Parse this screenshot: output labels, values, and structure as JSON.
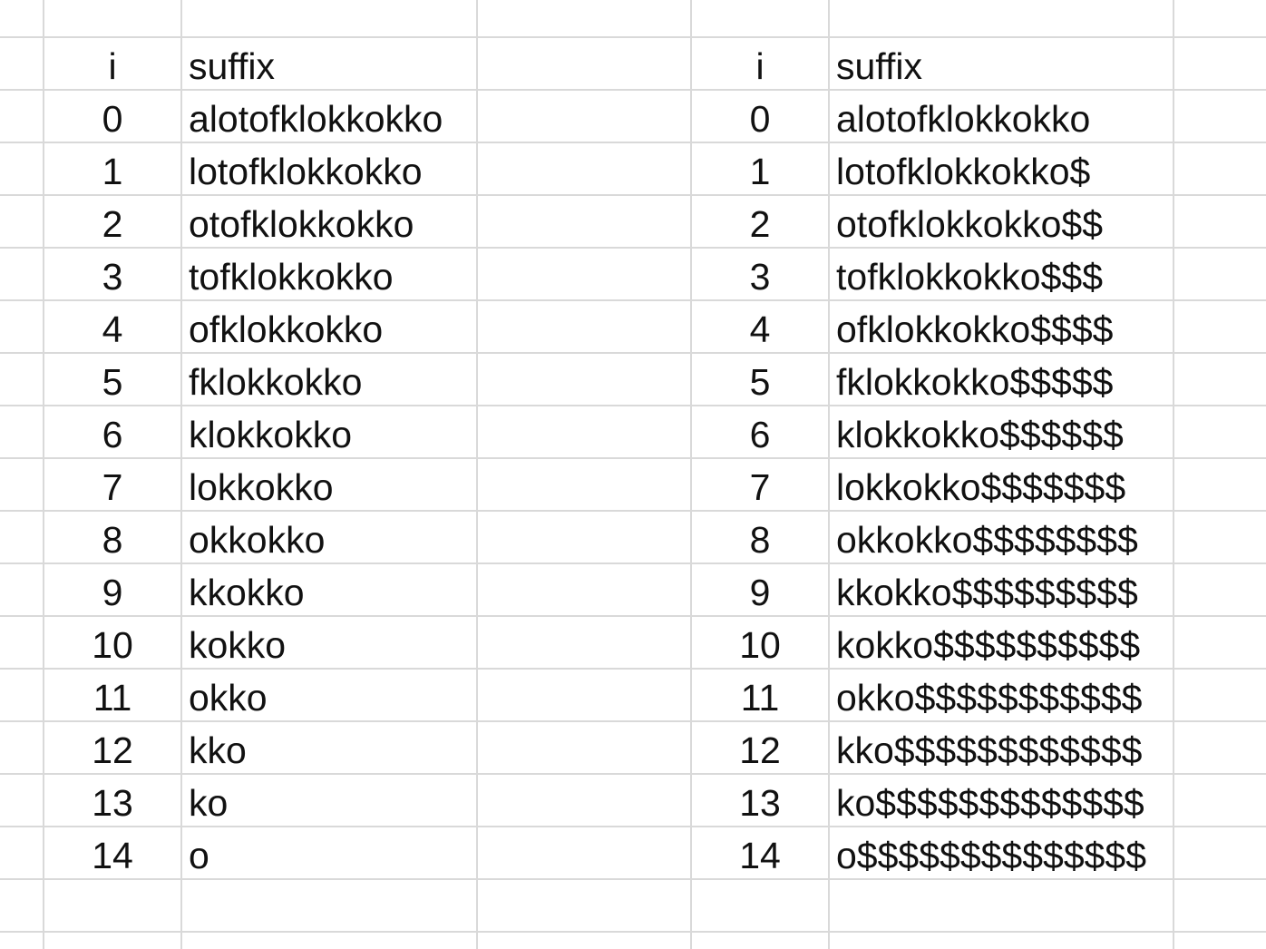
{
  "sheet": {
    "left_table": {
      "header": {
        "i": "i",
        "suffix": "suffix"
      },
      "rows": [
        {
          "i": "0",
          "suffix": "alotofklokkokko"
        },
        {
          "i": "1",
          "suffix": "lotofklokkokko"
        },
        {
          "i": "2",
          "suffix": "otofklokkokko"
        },
        {
          "i": "3",
          "suffix": "tofklokkokko"
        },
        {
          "i": "4",
          "suffix": "ofklokkokko"
        },
        {
          "i": "5",
          "suffix": "fklokkokko"
        },
        {
          "i": "6",
          "suffix": "klokkokko"
        },
        {
          "i": "7",
          "suffix": "lokkokko"
        },
        {
          "i": "8",
          "suffix": "okkokko"
        },
        {
          "i": "9",
          "suffix": "kkokko"
        },
        {
          "i": "10",
          "suffix": "kokko"
        },
        {
          "i": "11",
          "suffix": "okko"
        },
        {
          "i": "12",
          "suffix": "kko"
        },
        {
          "i": "13",
          "suffix": "ko"
        },
        {
          "i": "14",
          "suffix": "o"
        }
      ]
    },
    "right_table": {
      "header": {
        "i": "i",
        "suffix": "suffix"
      },
      "rows": [
        {
          "i": "0",
          "suffix": "alotofklokkokko"
        },
        {
          "i": "1",
          "suffix": "lotofklokkokko$"
        },
        {
          "i": "2",
          "suffix": "otofklokkokko$$"
        },
        {
          "i": "3",
          "suffix": "tofklokkokko$$$"
        },
        {
          "i": "4",
          "suffix": "ofklokkokko$$$$"
        },
        {
          "i": "5",
          "suffix": "fklokkokko$$$$$"
        },
        {
          "i": "6",
          "suffix": "klokkokko$$$$$$"
        },
        {
          "i": "7",
          "suffix": "lokkokko$$$$$$$"
        },
        {
          "i": "8",
          "suffix": "okkokko$$$$$$$$"
        },
        {
          "i": "9",
          "suffix": "kkokko$$$$$$$$$"
        },
        {
          "i": "10",
          "suffix": "kokko$$$$$$$$$$"
        },
        {
          "i": "11",
          "suffix": "okko$$$$$$$$$$$"
        },
        {
          "i": "12",
          "suffix": "kko$$$$$$$$$$$$"
        },
        {
          "i": "13",
          "suffix": "ko$$$$$$$$$$$$$"
        },
        {
          "i": "14",
          "suffix": "o$$$$$$$$$$$$$$"
        }
      ]
    }
  }
}
